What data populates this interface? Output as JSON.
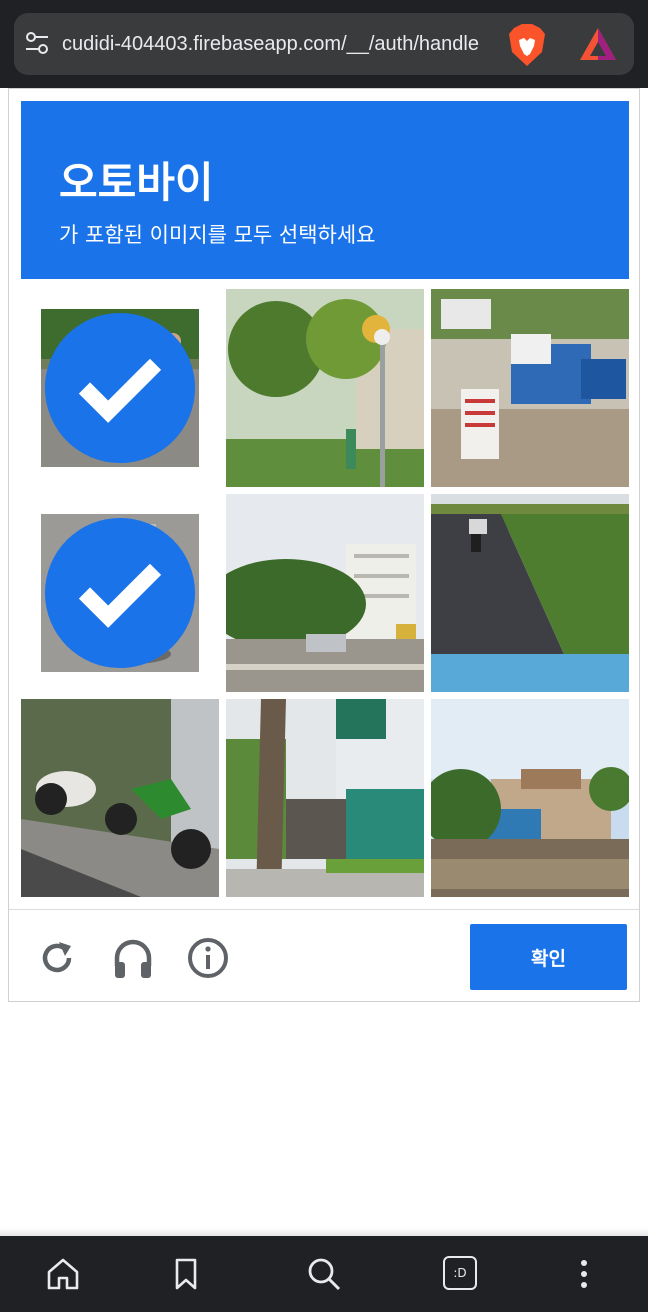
{
  "browser": {
    "url": "cudidi-404403.firebaseapp.com/__/auth/handle",
    "icons": [
      "tune-icon",
      "brave-lion-icon",
      "brave-rewards-icon"
    ]
  },
  "captcha": {
    "title": "오토바이",
    "instruction": "가 포함된 이미지를 모두 선택하세요",
    "accent_color": "#1a73e8",
    "tiles": [
      {
        "scene": "motorbike-riders-road",
        "selected": true
      },
      {
        "scene": "street-trees-lamp",
        "selected": false
      },
      {
        "scene": "trucks-signboard",
        "selected": false
      },
      {
        "scene": "motorbike-rider-back",
        "selected": true
      },
      {
        "scene": "road-buildings-trees",
        "selected": false
      },
      {
        "scene": "bike-path-rider",
        "selected": false
      },
      {
        "scene": "parked-motorbikes-sidewalk",
        "selected": false
      },
      {
        "scene": "tree-building-storefront",
        "selected": false
      },
      {
        "scene": "river-houses-market",
        "selected": false
      }
    ],
    "controls": {
      "reload_icon": "reload-icon",
      "audio_icon": "headphones-icon",
      "info_icon": "info-icon",
      "verify_label": "확인"
    }
  },
  "nav": {
    "icons": [
      "home-icon",
      "bookmark-icon",
      "search-icon",
      "tabs-icon",
      "more-icon"
    ],
    "tabs_label": ":D"
  }
}
